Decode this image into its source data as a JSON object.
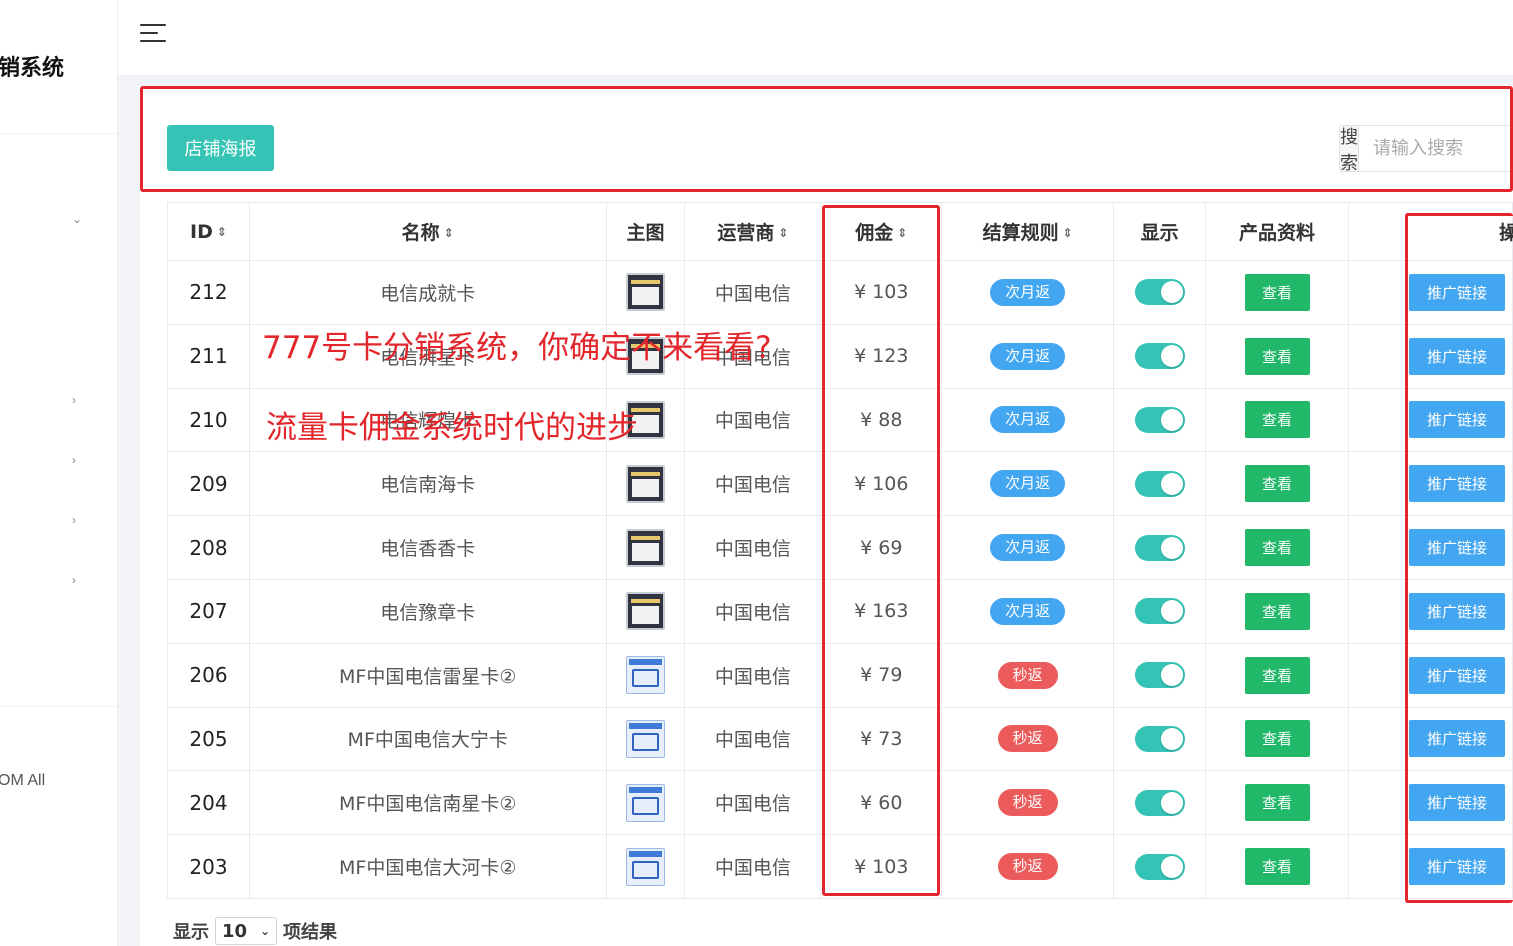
{
  "sidebar": {
    "brand": "销系统",
    "footer_text": "OM All"
  },
  "toolbar": {
    "poster_button": "店铺海报",
    "search_label": "搜索",
    "search_placeholder": "请输入搜索"
  },
  "table": {
    "headers": {
      "id": "ID",
      "name": "名称",
      "image": "主图",
      "carrier": "运营商",
      "commission": "佣金",
      "settlement": "结算规则",
      "display": "显示",
      "product_info": "产品资料",
      "operation": "操"
    },
    "rows": [
      {
        "id": "212",
        "name": "电信成就卡",
        "carrier": "中国电信",
        "commission": "¥ 103",
        "settlement": "次月返",
        "settlement_color": "#42a6f0",
        "display_on": true,
        "view": "查看",
        "promo": "推广链接",
        "thumb": "dark"
      },
      {
        "id": "211",
        "name": "电信湃星卡",
        "carrier": "中国电信",
        "commission": "¥ 123",
        "settlement": "次月返",
        "settlement_color": "#42a6f0",
        "display_on": true,
        "view": "查看",
        "promo": "推广链接",
        "thumb": "dark"
      },
      {
        "id": "210",
        "name": "电信辉煌卡",
        "carrier": "中国电信",
        "commission": "¥ 88",
        "settlement": "次月返",
        "settlement_color": "#42a6f0",
        "display_on": true,
        "view": "查看",
        "promo": "推广链接",
        "thumb": "dark"
      },
      {
        "id": "209",
        "name": "电信南海卡",
        "carrier": "中国电信",
        "commission": "¥ 106",
        "settlement": "次月返",
        "settlement_color": "#42a6f0",
        "display_on": true,
        "view": "查看",
        "promo": "推广链接",
        "thumb": "dark"
      },
      {
        "id": "208",
        "name": "电信香香卡",
        "carrier": "中国电信",
        "commission": "¥ 69",
        "settlement": "次月返",
        "settlement_color": "#42a6f0",
        "display_on": true,
        "view": "查看",
        "promo": "推广链接",
        "thumb": "dark"
      },
      {
        "id": "207",
        "name": "电信豫章卡",
        "carrier": "中国电信",
        "commission": "¥ 163",
        "settlement": "次月返",
        "settlement_color": "#42a6f0",
        "display_on": true,
        "view": "查看",
        "promo": "推广链接",
        "thumb": "dark"
      },
      {
        "id": "206",
        "name": "MF中国电信雷星卡②",
        "carrier": "中国电信",
        "commission": "¥ 79",
        "settlement": "秒返",
        "settlement_color": "#ec5b5b",
        "display_on": true,
        "view": "查看",
        "promo": "推广链接",
        "thumb": "light"
      },
      {
        "id": "205",
        "name": "MF中国电信大宁卡",
        "carrier": "中国电信",
        "commission": "¥ 73",
        "settlement": "秒返",
        "settlement_color": "#ec5b5b",
        "display_on": true,
        "view": "查看",
        "promo": "推广链接",
        "thumb": "light"
      },
      {
        "id": "204",
        "name": "MF中国电信南星卡②",
        "carrier": "中国电信",
        "commission": "¥ 60",
        "settlement": "秒返",
        "settlement_color": "#ec5b5b",
        "display_on": true,
        "view": "查看",
        "promo": "推广链接",
        "thumb": "light"
      },
      {
        "id": "203",
        "name": "MF中国电信大河卡②",
        "carrier": "中国电信",
        "commission": "¥ 103",
        "settlement": "秒返",
        "settlement_color": "#ec5b5b",
        "display_on": true,
        "view": "查看",
        "promo": "推广链接",
        "thumb": "light"
      }
    ]
  },
  "overlay": {
    "line1": "777号卡分销系统，你确定不来看看?",
    "line2": "流量卡佣金系统时代的进步"
  },
  "footer": {
    "show_label": "显示",
    "page_size": "10",
    "results_label": "项结果"
  },
  "colors": {
    "accent_teal": "#34c3b4",
    "view_green": "#22b86a",
    "promo_blue": "#42a6f0",
    "highlight_red": "#e3262b"
  }
}
